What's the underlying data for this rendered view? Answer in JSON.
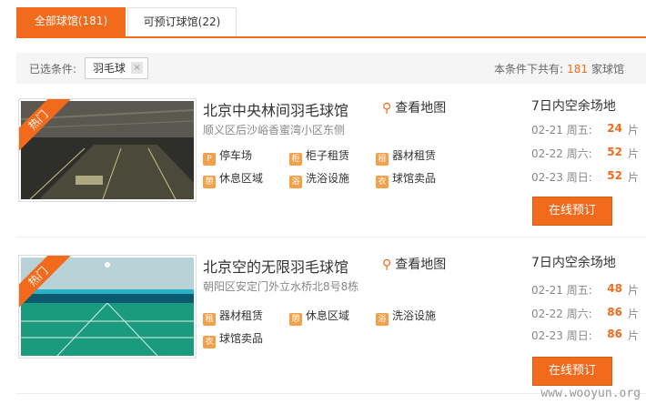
{
  "tabs": {
    "all": "全部球馆(181)",
    "bookable": "可预订球馆(22)"
  },
  "filter": {
    "label": "已选条件:",
    "chip": "羽毛球",
    "chip_close": "×",
    "result_prefix": "本条件下共有:",
    "result_count": "181",
    "result_suffix": "家球馆"
  },
  "venues": [
    {
      "badge": "热门",
      "name": "北京中央林间羽毛球馆",
      "map_label": "查看地图",
      "address": "顺义区后沙峪香蜜湾小区东侧",
      "facilities": [
        {
          "icon": "parking-icon",
          "glyph": "P",
          "label": "停车场"
        },
        {
          "icon": "locker-icon",
          "glyph": "柜",
          "label": "柜子租赁"
        },
        {
          "icon": "rental-icon",
          "glyph": "租",
          "label": "器材租赁"
        },
        {
          "icon": "sofa-icon",
          "glyph": "憩",
          "label": "休息区域"
        },
        {
          "icon": "shower-icon",
          "glyph": "浴",
          "label": "洗浴设施"
        },
        {
          "icon": "shirt-icon",
          "glyph": "衣",
          "label": "球馆卖品"
        }
      ],
      "avail_title": "7日内空余场地",
      "avail": [
        {
          "date": "02-21",
          "day": "周五:",
          "count": "24",
          "unit": "片"
        },
        {
          "date": "02-22",
          "day": "周六:",
          "count": "52",
          "unit": "片"
        },
        {
          "date": "02-23",
          "day": "周日:",
          "count": "52",
          "unit": "片"
        }
      ],
      "book_label": "在线预订"
    },
    {
      "badge": "热门",
      "name": "北京空的无限羽毛球馆",
      "map_label": "查看地图",
      "address": "朝阳区安定门外立水桥北8号8栋",
      "facilities": [
        {
          "icon": "rental-icon",
          "glyph": "租",
          "label": "器材租赁"
        },
        {
          "icon": "sofa-icon",
          "glyph": "憩",
          "label": "休息区域"
        },
        {
          "icon": "shower-icon",
          "glyph": "浴",
          "label": "洗浴设施"
        },
        {
          "icon": "shirt-icon",
          "glyph": "衣",
          "label": "球馆卖品"
        }
      ],
      "avail_title": "7日内空余场地",
      "avail": [
        {
          "date": "02-21",
          "day": "周五:",
          "count": "48",
          "unit": "片"
        },
        {
          "date": "02-22",
          "day": "周六:",
          "count": "86",
          "unit": "片"
        },
        {
          "date": "02-23",
          "day": "周日:",
          "count": "86",
          "unit": "片"
        }
      ],
      "book_label": "在线预订"
    }
  ],
  "watermark": "www.wooyun.org",
  "colors": {
    "accent": "#f26b1d"
  }
}
